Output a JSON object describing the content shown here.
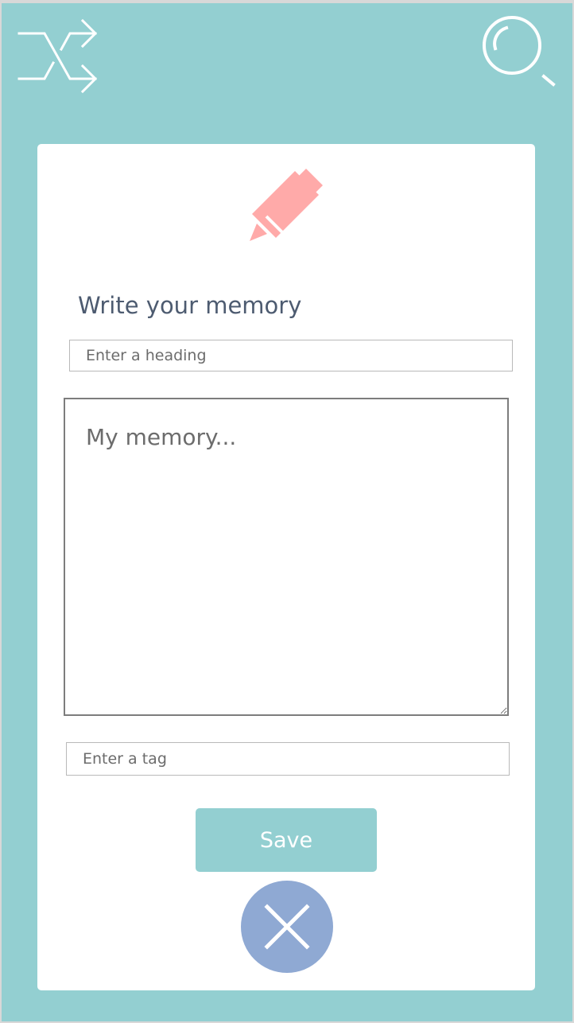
{
  "header": {
    "left_icon": "shuffle-icon",
    "right_icon": "search-icon"
  },
  "card": {
    "decorative_icon": "pencil-icon",
    "title": "Write your memory",
    "heading_input": {
      "placeholder": "Enter a heading",
      "value": ""
    },
    "memory_input": {
      "placeholder": "My memory...",
      "value": ""
    },
    "tag_input": {
      "placeholder": "Enter a tag",
      "value": ""
    },
    "save_label": "Save",
    "close_icon": "close-icon"
  },
  "colors": {
    "background": "#93cfd1",
    "card": "#ffffff",
    "accent": "#ffaaa9",
    "title": "#4d5b70",
    "close_button": "#8fa9d3"
  }
}
